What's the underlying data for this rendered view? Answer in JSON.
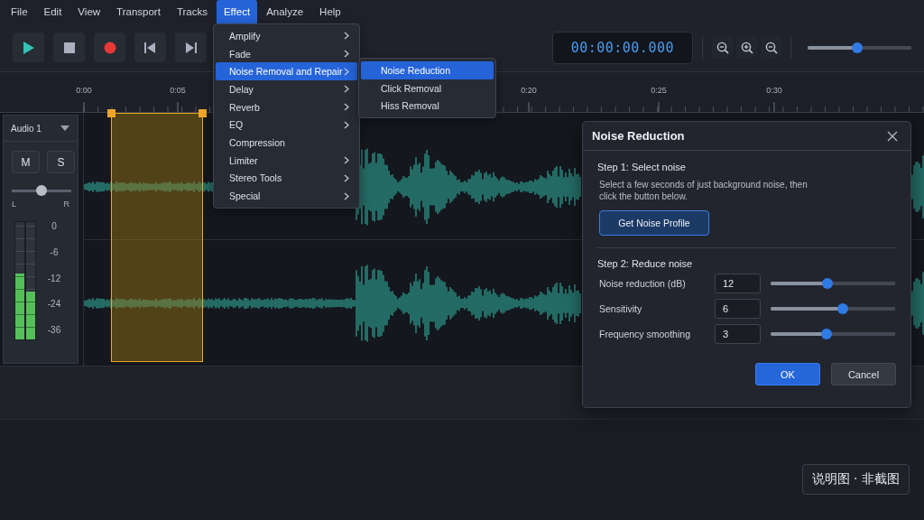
{
  "menu_bar": [
    {
      "label": "File",
      "selected": false
    },
    {
      "label": "Edit",
      "selected": false
    },
    {
      "label": "View",
      "selected": false
    },
    {
      "label": "Transport",
      "selected": false
    },
    {
      "label": "Tracks",
      "selected": false
    },
    {
      "label": "Effect",
      "selected": true
    },
    {
      "label": "Analyze",
      "selected": false
    },
    {
      "label": "Help",
      "selected": false
    }
  ],
  "effect_menu": [
    {
      "label": "Amplify",
      "submenu": true,
      "selected": false
    },
    {
      "label": "Fade",
      "submenu": true,
      "selected": false
    },
    {
      "label": "Noise Removal and Repair",
      "submenu": true,
      "selected": true
    },
    {
      "label": "Delay",
      "submenu": true,
      "selected": false
    },
    {
      "label": "Reverb",
      "submenu": true,
      "selected": false
    },
    {
      "label": "EQ",
      "submenu": true,
      "selected": false
    },
    {
      "label": "Compression",
      "submenu": false,
      "selected": false
    },
    {
      "label": "Limiter",
      "submenu": true,
      "selected": false
    },
    {
      "label": "Stereo Tools",
      "submenu": true,
      "selected": false
    },
    {
      "label": "Special",
      "submenu": true,
      "selected": false
    }
  ],
  "submenu": [
    {
      "label": "Noise Reduction",
      "selected": true
    },
    {
      "label": "Click Removal",
      "selected": false
    },
    {
      "label": "Hiss Removal",
      "selected": false
    }
  ],
  "transport": [
    {
      "kind": "play"
    },
    {
      "kind": "stop"
    },
    {
      "kind": "record"
    },
    {
      "kind": "skip-start"
    },
    {
      "kind": "skip-end"
    }
  ],
  "time_display": "00:00:00.000",
  "zoom_buttons": [
    {
      "kind": "zoom-out"
    },
    {
      "kind": "zoom-in"
    },
    {
      "kind": "zoom-out"
    }
  ],
  "zoom_slider": {
    "level": 0.48
  },
  "ruler": [
    "0:00",
    "0:05",
    "0:20",
    "0:25",
    "0:30"
  ],
  "track": {
    "name": "Audio 1",
    "mute": "M",
    "solo": "S",
    "pan": {
      "level": 0.5,
      "left": "L",
      "right": "R"
    },
    "meter": {
      "channels": [
        {
          "level": 0.56
        },
        {
          "level": 0.41
        }
      ],
      "scale": [
        "0",
        "-6",
        "-12",
        "-24",
        "-36"
      ]
    }
  },
  "dialog": {
    "title": "Noise Reduction",
    "step1": "Step 1: Select noise",
    "hint": "Select a few seconds of just background noise, then click the button below.",
    "profile_button": "Get Noise Profile",
    "step2": "Step 2: Reduce noise",
    "params": [
      {
        "label": "Noise reduction (dB)",
        "value": "12",
        "level": 0.46
      },
      {
        "label": "Sensitivity",
        "value": "6",
        "level": 0.58
      },
      {
        "label": "Frequency smoothing",
        "value": "3",
        "level": 0.45
      }
    ],
    "buttons": [
      {
        "label": "OK",
        "kind": "primary"
      },
      {
        "label": "Cancel",
        "kind": "secondary"
      }
    ]
  },
  "note_badge": "说明图 · 非截图"
}
